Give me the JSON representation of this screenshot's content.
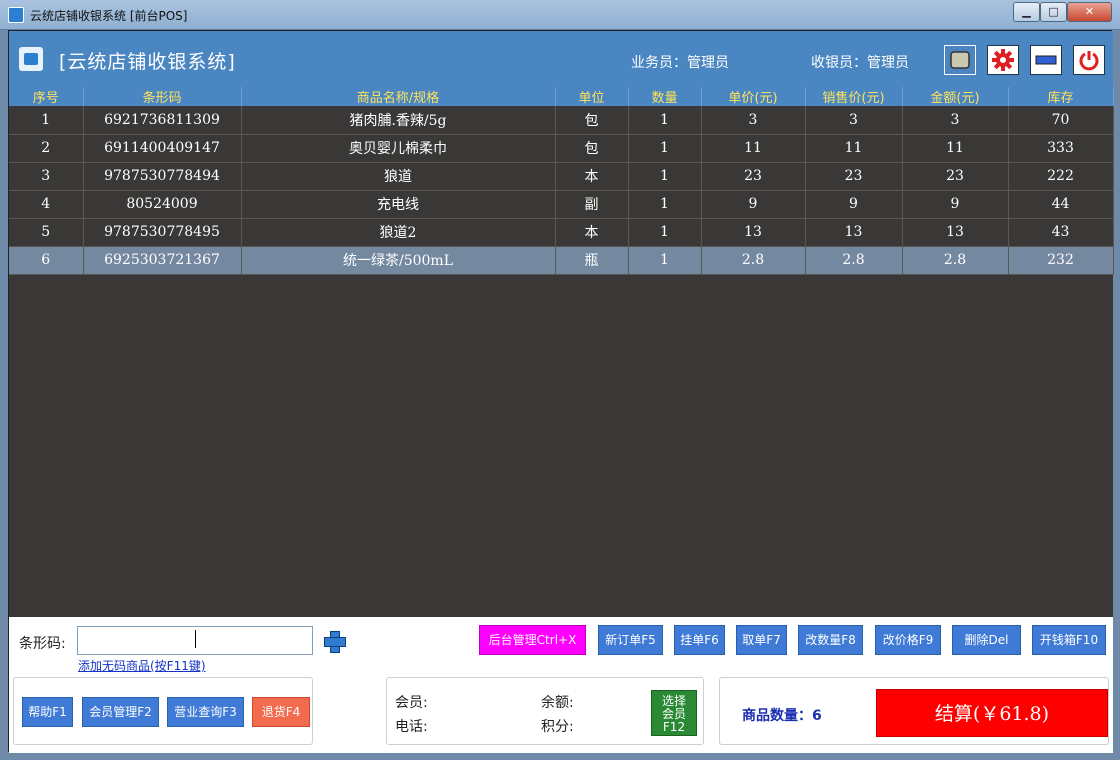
{
  "window": {
    "title": "云统店铺收银系统 [前台POS]",
    "min_glyph": "▁",
    "max_glyph": "□",
    "close_glyph": "✕"
  },
  "header": {
    "title": "[云统店铺收银系统]",
    "salesperson": "业务员：管理员",
    "cashier": "收银员：管理员"
  },
  "table": {
    "columns": [
      "序号",
      "条形码",
      "商品名称/规格",
      "单位",
      "数量",
      "单价(元)",
      "销售价(元)",
      "金额(元)",
      "库存"
    ],
    "rows": [
      [
        "1",
        "6921736811309",
        "猪肉脯.香辣/5g",
        "包",
        "1",
        "3",
        "3",
        "3",
        "70"
      ],
      [
        "2",
        "6911400409147",
        "奥贝婴儿棉柔巾",
        "包",
        "1",
        "11",
        "11",
        "11",
        "333"
      ],
      [
        "3",
        "9787530778494",
        "狼道",
        "本",
        "1",
        "23",
        "23",
        "23",
        "222"
      ],
      [
        "4",
        "80524009",
        "充电线",
        "副",
        "1",
        "9",
        "9",
        "9",
        "44"
      ],
      [
        "5",
        "9787530778495",
        "狼道2",
        "本",
        "1",
        "13",
        "13",
        "13",
        "43"
      ],
      [
        "6",
        "6925303721367",
        "统一绿茶/500mL",
        "瓶",
        "1",
        "2.8",
        "2.8",
        "2.8",
        "232"
      ]
    ],
    "selected_row": 6
  },
  "barcode": {
    "label": "条形码:",
    "value": "",
    "add_no_code_link": "添加无码商品(按F11键)"
  },
  "buttons": {
    "backend": "后台管理Ctrl+X",
    "new_order": "新订单F5",
    "hold": "挂单F6",
    "retrieve": "取单F7",
    "change_qty": "改数量F8",
    "change_price": "改价格F9",
    "delete": "删除Del",
    "cash_drawer": "开钱箱F10",
    "help": "帮助F1",
    "member_mgmt": "会员管理F2",
    "sales_query": "营业查询F3",
    "return": "退货F4"
  },
  "member": {
    "member_label": "会员:",
    "phone_label": "电话:",
    "balance_label": "余额:",
    "points_label": "积分:",
    "select_btn_line1": "选择",
    "select_btn_line2": "会员",
    "select_btn_line3": "F12"
  },
  "summary": {
    "item_count": "商品数量：6",
    "checkout": "结算(￥61.8)"
  },
  "colors": {
    "header_blue": "#4a86c1",
    "grid_bg": "#3a3836",
    "selected_row": "#7488a0",
    "backend_btn": "#ff00ff",
    "fn_btn": "#3f7ad6",
    "return_btn": "#f26b4f",
    "select_member_btn": "#2a8a34",
    "checkout_btn": "#ff0000"
  },
  "icons": [
    "app-icon",
    "screen-icon",
    "gear-icon",
    "minimize-icon",
    "power-icon",
    "plus-icon"
  ]
}
